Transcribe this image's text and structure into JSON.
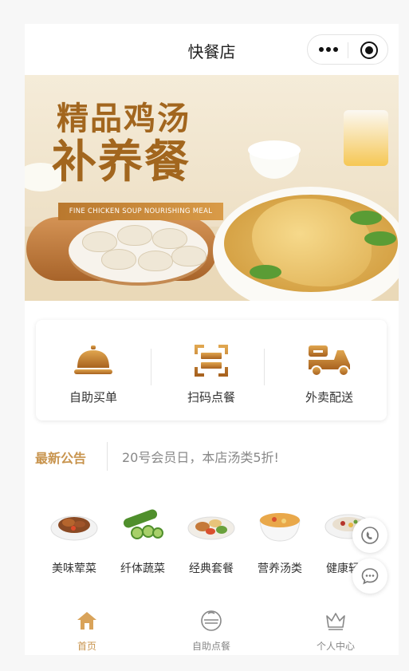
{
  "navbar": {
    "title": "快餐店"
  },
  "banner": {
    "title_line1": "精品鸡汤",
    "title_line2": "补养餐",
    "ribbon_text": "FINE CHICKEN SOUP NOURISHING MEAL"
  },
  "actions": [
    {
      "label": "自助买单",
      "icon": "cloche-icon"
    },
    {
      "label": "扫码点餐",
      "icon": "scan-icon"
    },
    {
      "label": "外卖配送",
      "icon": "scooter-icon"
    }
  ],
  "notice": {
    "tag": "最新公告",
    "text": "20号会员日，本店汤类5折!"
  },
  "categories": [
    {
      "name": "美味荤菜",
      "icon": "meat-dish-icon"
    },
    {
      "name": "纤体蔬菜",
      "icon": "cucumber-icon"
    },
    {
      "name": "经典套餐",
      "icon": "set-meal-icon"
    },
    {
      "name": "营养汤类",
      "icon": "soup-icon"
    },
    {
      "name": "健康轻食",
      "icon": "light-meal-icon"
    }
  ],
  "fabs": [
    {
      "icon": "phone-icon"
    },
    {
      "icon": "chat-icon"
    }
  ],
  "tabbar": {
    "items": [
      {
        "label": "首页",
        "icon": "home-icon",
        "active": true
      },
      {
        "label": "自助点餐",
        "icon": "bowl-icon",
        "active": false
      },
      {
        "label": "个人中心",
        "icon": "crown-icon",
        "active": false
      }
    ]
  },
  "colors": {
    "accent": "#c8944e",
    "brand_brown": "#b2722c"
  }
}
